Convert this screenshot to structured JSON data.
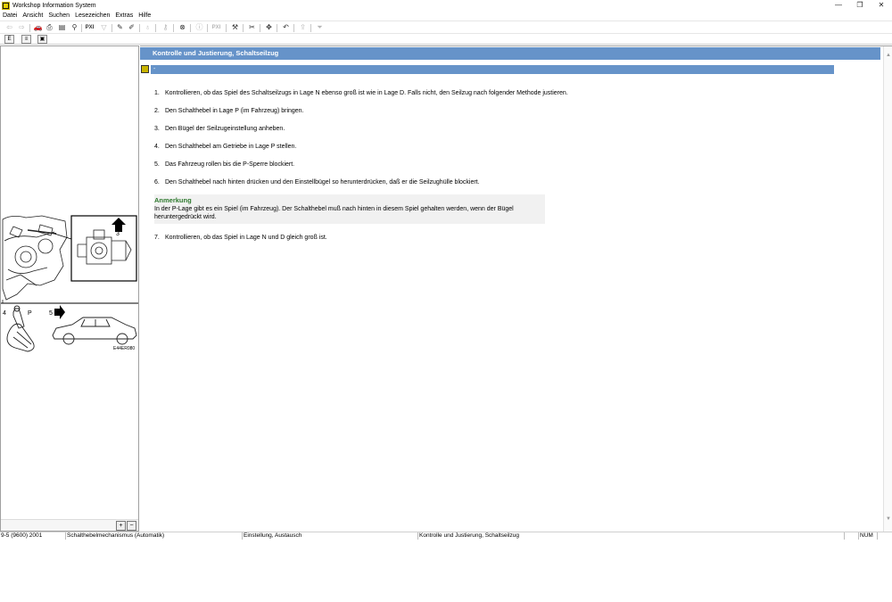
{
  "window": {
    "title": "Workshop Information System",
    "minimize": "—",
    "maximize": "❐",
    "close": "✕"
  },
  "menu": [
    "Datei",
    "Ansicht",
    "Suchen",
    "Lesezeichen",
    "Extras",
    "Hilfe"
  ],
  "toolbar": {
    "pxi_label": "PXI",
    "pxi_label_2": "PXI"
  },
  "page": {
    "header": "Kontrolle und Justierung, Schaltseilzug",
    "section": "-",
    "steps": [
      {
        "num": "1.",
        "text": "Kontrollieren, ob das Spiel des Schaltseilzugs in Lage N ebenso groß ist wie in Lage D. Falls nicht, den Seilzug nach folgender Methode justieren."
      },
      {
        "num": "2.",
        "text": "Den Schalthebel in Lage P (im Fahrzeug) bringen."
      },
      {
        "num": "3.",
        "text": "Den Bügel der Seilzugeinstellung anheben."
      },
      {
        "num": "4.",
        "text": "Den Schalthebel am Getriebe in Lage P stellen."
      },
      {
        "num": "5.",
        "text": "Das Fahrzeug rollen bis die P-Sperre blockiert."
      },
      {
        "num": "6.",
        "text": "Den Schalthebel nach hinten drücken und den Einstellbügel so herunterdrücken, daß er die Seilzughülle blockiert."
      }
    ],
    "note": {
      "title": "Anmerkung",
      "text": "In der P-Lage gibt es ein Spiel (im Fahrzeug). Der Schalthebel muß nach hinten in diesem Spiel gehalten werden, wenn der Bügel heruntergedrückt wird."
    },
    "final_step": {
      "num": "7.",
      "text": "Kontrollieren, ob das Spiel in Lage N und D gleich groß ist."
    }
  },
  "figure": {
    "label_3": "3",
    "label_4": "4",
    "label_p": "P",
    "label_5": "5",
    "code": "E44ER080"
  },
  "status": [
    "9-5 (9600) 2001",
    "Schalthebelmechanismus (Automatik)",
    "Einstellung, Austausch",
    "Kontrolle und Justierung, Schaltseilzug",
    "",
    "NUM"
  ]
}
